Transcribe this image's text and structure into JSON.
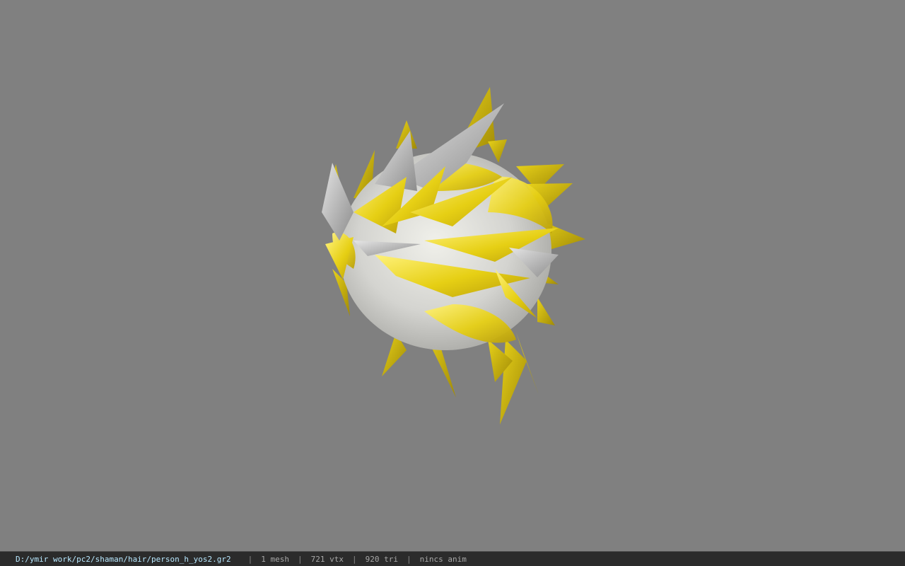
{
  "viewport": {
    "background": "#808080",
    "model_icon": "spiky-hair-mesh-render"
  },
  "status": {
    "path": "D:/ymir work/pc2/shaman/hair/person_h_yos2.gr2",
    "separator": "|",
    "mesh_count": "1 mesh",
    "vertex_count": "721 vtx",
    "triangle_count": "920 tri",
    "anim": "nincs anim"
  },
  "colors": {
    "hair_yellow": "#e8d21a",
    "hair_white": "#d8d8d8",
    "hair_shadow": "#a0a0a0",
    "status_bg": "#2b2b2b",
    "path_text": "#b8e8ff"
  }
}
